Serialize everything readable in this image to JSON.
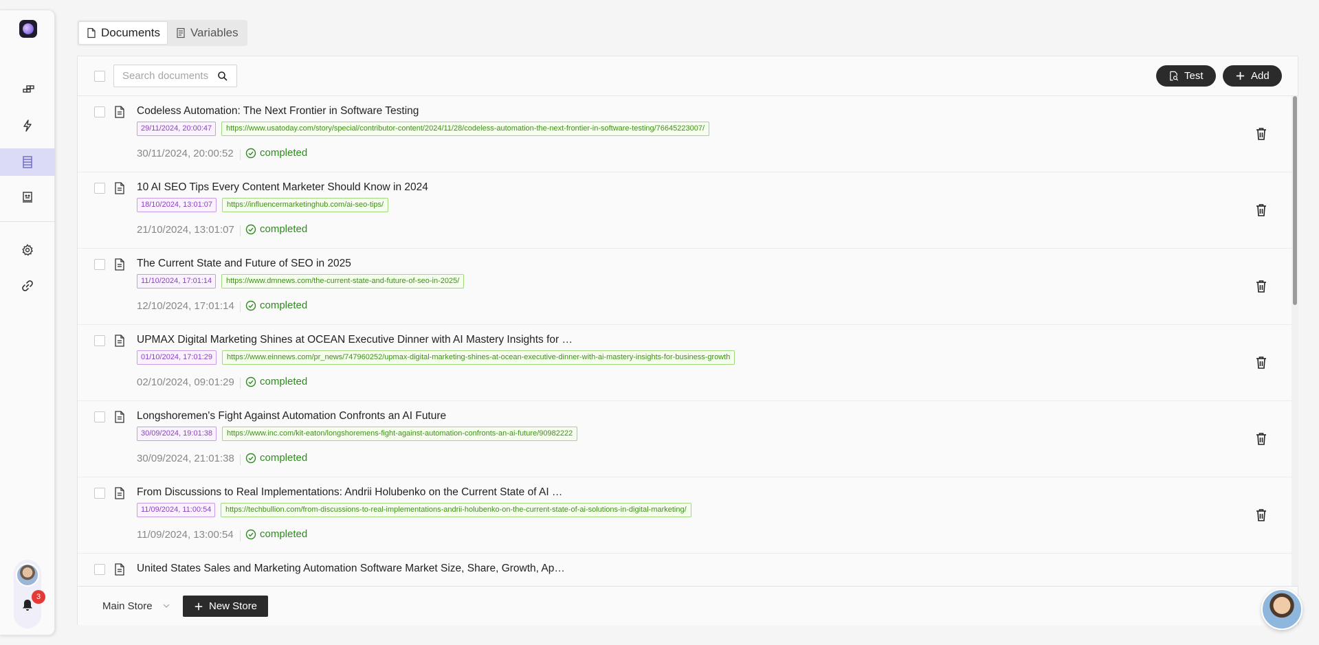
{
  "tabs": [
    {
      "label": "Documents",
      "icon": "document-icon",
      "active": true
    },
    {
      "label": "Variables",
      "icon": "variables-icon",
      "active": false
    }
  ],
  "toolbar": {
    "search_placeholder": "Search documents",
    "test_label": "Test",
    "add_label": "Add"
  },
  "notifications": {
    "count": "3"
  },
  "documents": [
    {
      "title": "Codeless Automation: The Next Frontier in Software Testing",
      "created": "29/11/2024, 20:00:47",
      "url": "https://www.usatoday.com/story/special/contributor-content/2024/11/28/codeless-automation-the-next-frontier-in-software-testing/76645223007/",
      "updated": "30/11/2024, 20:00:52",
      "status": "completed"
    },
    {
      "title": "10 AI SEO Tips Every Content Marketer Should Know in 2024",
      "created": "18/10/2024, 13:01:07",
      "url": "https://influencermarketinghub.com/ai-seo-tips/",
      "updated": "21/10/2024, 13:01:07",
      "status": "completed"
    },
    {
      "title": "The Current State and Future of SEO in 2025",
      "created": "11/10/2024, 17:01:14",
      "url": "https://www.dmnews.com/the-current-state-and-future-of-seo-in-2025/",
      "updated": "12/10/2024, 17:01:14",
      "status": "completed"
    },
    {
      "title": "UPMAX Digital Marketing Shines at OCEAN Executive Dinner with AI Mastery Insights for …",
      "created": "01/10/2024, 17:01:29",
      "url": "https://www.einnews.com/pr_news/747960252/upmax-digital-marketing-shines-at-ocean-executive-dinner-with-ai-mastery-insights-for-business-growth",
      "updated": "02/10/2024, 09:01:29",
      "status": "completed"
    },
    {
      "title": "Longshoremen's Fight Against Automation Confronts an AI Future",
      "created": "30/09/2024, 19:01:38",
      "url": "https://www.inc.com/kit-eaton/longshoremens-fight-against-automation-confronts-an-ai-future/90982222",
      "updated": "30/09/2024, 21:01:38",
      "status": "completed"
    },
    {
      "title": "From Discussions to Real Implementations: Andrii Holubenko on the Current State of AI …",
      "created": "11/09/2024, 11:00:54",
      "url": "https://techbullion.com/from-discussions-to-real-implementations-andrii-holubenko-on-the-current-state-of-ai-solutions-in-digital-marketing/",
      "updated": "11/09/2024, 13:00:54",
      "status": "completed"
    },
    {
      "title": "United States Sales and Marketing Automation Software Market Size, Share, Growth, Ap…",
      "created": "",
      "url": "",
      "updated": "",
      "status": ""
    }
  ],
  "footer": {
    "store_label": "Main Store",
    "new_store_label": "New Store"
  }
}
